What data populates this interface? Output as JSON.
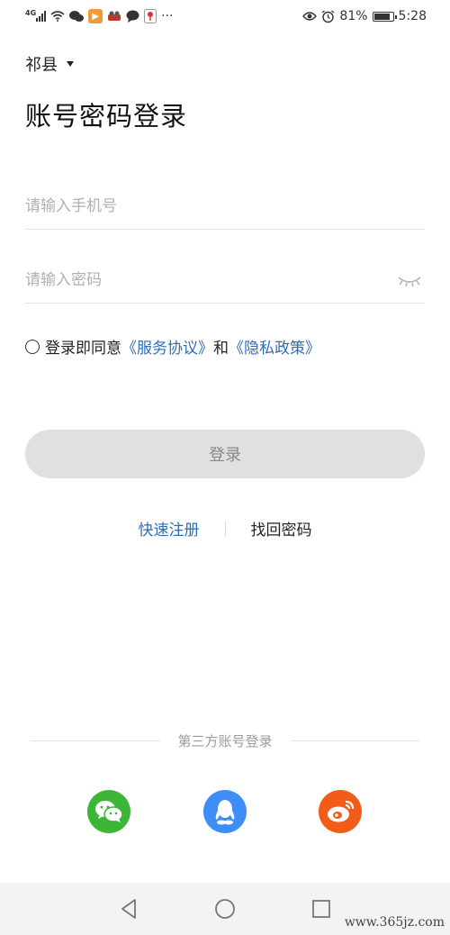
{
  "status_bar": {
    "network": "4G",
    "battery": "81%",
    "time": "5:28",
    "more": "···",
    "icons": [
      "signal-icon",
      "wifi-icon",
      "wechat-icon",
      "video-app-icon",
      "app-icon",
      "chat-icon",
      "map-pin-icon",
      "eye-icon",
      "alarm-icon",
      "battery-icon"
    ]
  },
  "location": {
    "label": "祁县"
  },
  "title": "账号密码登录",
  "phone_input": {
    "placeholder": "请输入手机号",
    "value": ""
  },
  "password_input": {
    "placeholder": "请输入密码",
    "value": ""
  },
  "agreement": {
    "prefix": "登录即同意",
    "service_link": "《服务协议》",
    "conjunction": "和",
    "privacy_link": "《隐私政策》"
  },
  "login_button": "登录",
  "aux_links": {
    "register": "快速注册",
    "recover": "找回密码"
  },
  "third_party": {
    "label": "第三方账号登录",
    "providers": [
      "wechat",
      "qq",
      "weibo"
    ]
  },
  "watermark": "www.365jz.com",
  "colors": {
    "link": "#2f6eb5",
    "wechat": "#3db536",
    "qq": "#3e8ef7",
    "weibo": "#f25c19",
    "button_bg": "#e0e0e0"
  }
}
